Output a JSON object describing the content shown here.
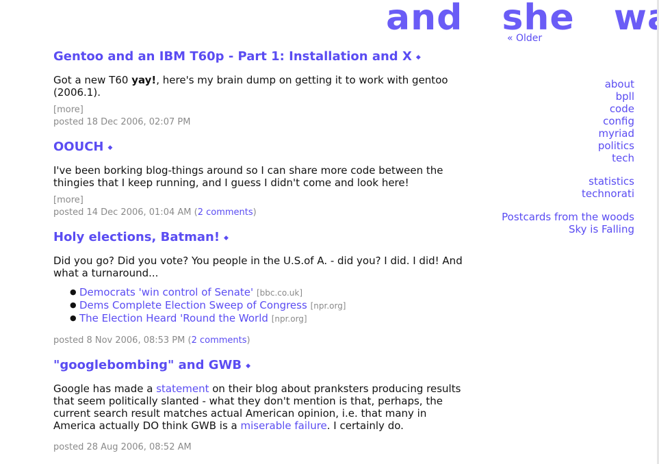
{
  "header": {
    "logo_words": [
      "and",
      "she",
      "was"
    ],
    "older_link": "« Older"
  },
  "posts": [
    {
      "title": "Gentoo and an IBM T60p - Part 1: Installation and X",
      "body_before": "Got a new T60 ",
      "body_bold": "yay!",
      "body_after": ", here's my brain dump on getting it to work with gentoo (2006.1).",
      "more": "[more]",
      "posted": "posted 18 Dec 2006, 02:07 PM"
    },
    {
      "title": "OOUCH",
      "body": "I've been borking blog-things around so I can share more code between the thingies that I keep running, and I guess I didn't come and look here!",
      "more": "[more]",
      "posted": "posted 14 Dec 2006, 01:04 AM (",
      "comments": "2 comments",
      "posted_close": ")"
    },
    {
      "title": "Holy elections, Batman!",
      "body": "Did you go? Did you vote? You people in the U.S.of A. - did you? I did. I did! And what a turnaround...",
      "links": [
        {
          "text": "Democrats 'win control of Senate'",
          "source": "[bbc.co.uk]"
        },
        {
          "text": "Dems Complete Election Sweep of Congress",
          "source": "[npr.org]"
        },
        {
          "text": "The Election Heard 'Round the World",
          "source": "[npr.org]"
        }
      ],
      "posted": "posted 8 Nov 2006, 08:53 PM (",
      "comments": "2 comments",
      "posted_close": ")"
    },
    {
      "title": "\"googlebombing\" and GWB",
      "body_1": "Google has made a ",
      "link_1": "statement",
      "body_2": " on their blog about pranksters producing results that seem politically slanted - what they don't mention is that, perhaps, the current search result matches actual American opinion, i.e. that many in America actually DO think GWB is a ",
      "link_2": "miserable failure",
      "body_3": ". I certainly do.",
      "posted": "posted 28 Aug 2006, 08:52 AM"
    }
  ],
  "permalink_glyph": "◆",
  "bullet_glyph": "●",
  "sidebar": {
    "sections": [
      "about",
      "bpll",
      "code",
      "config",
      "myriad",
      "politics",
      "tech"
    ],
    "stats": [
      "statistics",
      "technorati"
    ],
    "blogroll": [
      "Postcards from the woods",
      "Sky is Falling"
    ]
  },
  "colors": {
    "link": "#5a4cf2",
    "logo": "#6a5cf6",
    "muted": "#8a8a8a"
  }
}
